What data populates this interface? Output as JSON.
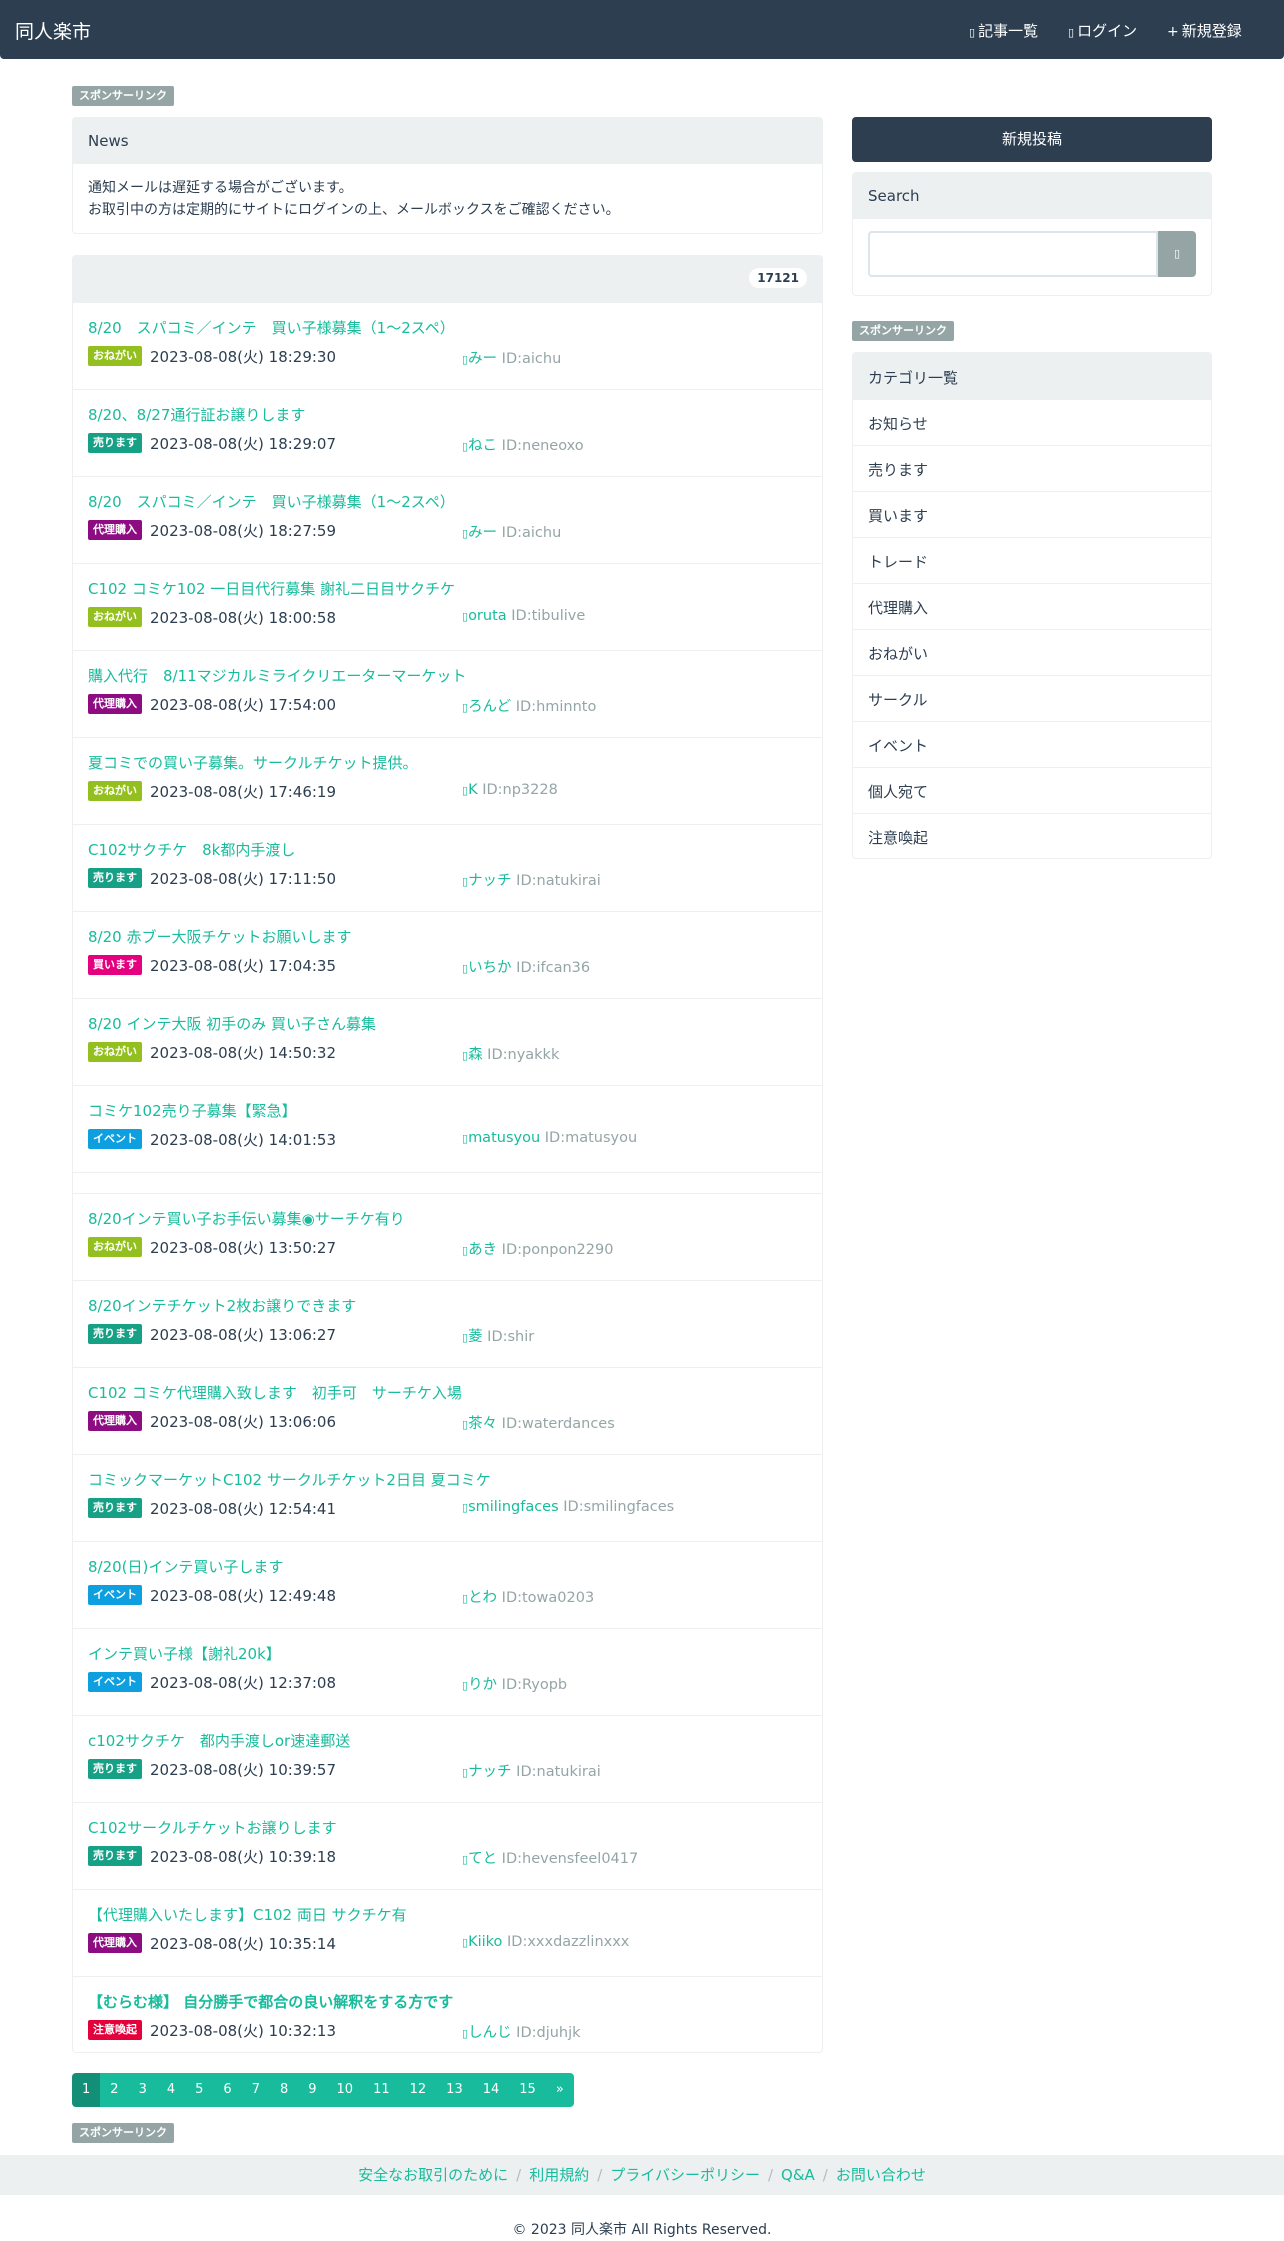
{
  "header": {
    "brand": "同人楽市",
    "nav": [
      {
        "icon": "list-icon",
        "label": "記事一覧"
      },
      {
        "icon": "login-icon",
        "label": "ログイン"
      },
      {
        "icon": "plus-icon",
        "label": "新規登録"
      }
    ]
  },
  "sponsor_label": "スポンサーリンク",
  "news": {
    "title": "News",
    "lines": [
      "通知メールは遅延する場合がございます。",
      "お取引中の方は定期的にサイトにログインの上、メールボックスをご確認ください。"
    ]
  },
  "post_count": "17121",
  "category_colors": {
    "おねがい": "#93c01f",
    "売ります": "#16a085",
    "代理購入": "#8e0c82",
    "買います": "#e5007f",
    "イベント": "#0d9fe0",
    "注意喚起": "#e4003a"
  },
  "posts": [
    {
      "title": "8/20　スパコミ／インテ　買い子様募集（1〜2スペ）",
      "category": "おねがい",
      "date": "2023-08-08(火) 18:29:30",
      "user": "みー",
      "id": "ID:aichu"
    },
    {
      "title": "8/20、8/27通行証お譲りします",
      "category": "売ります",
      "date": "2023-08-08(火) 18:29:07",
      "user": "ねこ",
      "id": "ID:neneoxo"
    },
    {
      "title": "8/20　スパコミ／インテ　買い子様募集（1〜2スペ）",
      "category": "代理購入",
      "date": "2023-08-08(火) 18:27:59",
      "user": "みー",
      "id": "ID:aichu"
    },
    {
      "title": "C102 コミケ102 一日目代行募集 謝礼二日目サクチケ",
      "category": "おねがい",
      "date": "2023-08-08(火) 18:00:58",
      "user": "oruta",
      "id": "ID:tibulive"
    },
    {
      "title": "購入代行　8/11マジカルミライクリエーターマーケット",
      "category": "代理購入",
      "date": "2023-08-08(火) 17:54:00",
      "user": "ろんど",
      "id": "ID:hminnto"
    },
    {
      "title": "夏コミでの買い子募集。サークルチケット提供。",
      "category": "おねがい",
      "date": "2023-08-08(火) 17:46:19",
      "user": "K",
      "id": "ID:np3228"
    },
    {
      "title": "C102サクチケ　8k都内手渡し",
      "category": "売ります",
      "date": "2023-08-08(火) 17:11:50",
      "user": "ナッチ",
      "id": "ID:natukirai"
    },
    {
      "title": "8/20 赤ブー大阪チケットお願いします",
      "category": "買います",
      "date": "2023-08-08(火) 17:04:35",
      "user": "いちか",
      "id": "ID:ifcan36"
    },
    {
      "title": "8/20 インテ大阪 初手のみ 買い子さん募集",
      "category": "おねがい",
      "date": "2023-08-08(火) 14:50:32",
      "user": "森",
      "id": "ID:nyakkk"
    },
    {
      "title": "コミケ102売り子募集【緊急】",
      "category": "イベント",
      "date": "2023-08-08(火) 14:01:53",
      "user": "matusyou",
      "id": "ID:matusyou"
    },
    {
      "title": "8/20インテ買い子お手伝い募集◉サーチケ有り",
      "category": "おねがい",
      "date": "2023-08-08(火) 13:50:27",
      "user": "あき",
      "id": "ID:ponpon2290"
    },
    {
      "title": "8/20インテチケット2枚お譲りできます",
      "category": "売ります",
      "date": "2023-08-08(火) 13:06:27",
      "user": "菱",
      "id": "ID:shir"
    },
    {
      "title": "C102 コミケ代理購入致します　初手可　サーチケ入場",
      "category": "代理購入",
      "date": "2023-08-08(火) 13:06:06",
      "user": "茶々",
      "id": "ID:waterdances"
    },
    {
      "title": "コミックマーケットC102 サークルチケット2日目 夏コミケ",
      "category": "売ります",
      "date": "2023-08-08(火) 12:54:41",
      "user": "smilingfaces",
      "id": "ID:smilingfaces"
    },
    {
      "title": "8/20(日)インテ買い子します",
      "category": "イベント",
      "date": "2023-08-08(火) 12:49:48",
      "user": "とわ",
      "id": "ID:towa0203"
    },
    {
      "title": "インテ買い子様【謝礼20k】",
      "category": "イベント",
      "date": "2023-08-08(火) 12:37:08",
      "user": "りか",
      "id": "ID:Ryopb"
    },
    {
      "title": "c102サクチケ　都内手渡しor速達郵送",
      "category": "売ります",
      "date": "2023-08-08(火) 10:39:57",
      "user": "ナッチ",
      "id": "ID:natukirai"
    },
    {
      "title": "C102サークルチケットお譲りします",
      "category": "売ります",
      "date": "2023-08-08(火) 10:39:18",
      "user": "てと",
      "id": "ID:hevensfeel0417"
    },
    {
      "title": "【代理購入いたします】C102 両日 サクチケ有",
      "category": "代理購入",
      "date": "2023-08-08(火) 10:35:14",
      "user": "Kiiko",
      "id": "ID:xxxdazzlinxxx"
    },
    {
      "title": "【むらむ様】 自分勝手で都合の良い解釈をする方です",
      "category": "注意喚起",
      "date": "2023-08-08(火) 10:32:13",
      "user": "しんじ",
      "id": "ID:djuhjk"
    }
  ],
  "sidebar": {
    "new_post": "新規投稿",
    "search_title": "Search",
    "search_button_icon": "search-icon",
    "categories_title": "カテゴリ一覧",
    "categories": [
      "お知らせ",
      "売ります",
      "買います",
      "トレード",
      "代理購入",
      "おねがい",
      "サークル",
      "イベント",
      "個人宛て",
      "注意喚起"
    ]
  },
  "pagination": {
    "pages": [
      "1",
      "2",
      "3",
      "4",
      "5",
      "6",
      "7",
      "8",
      "9",
      "10",
      "11",
      "12",
      "13",
      "14",
      "15",
      "»"
    ],
    "active": "1"
  },
  "footer": {
    "links": [
      "安全なお取引のために",
      "利用規約",
      "プライバシーポリシー",
      "Q&A",
      "お問い合わせ"
    ],
    "copyright": "© 2023 同人楽市 All Rights Reserved."
  }
}
